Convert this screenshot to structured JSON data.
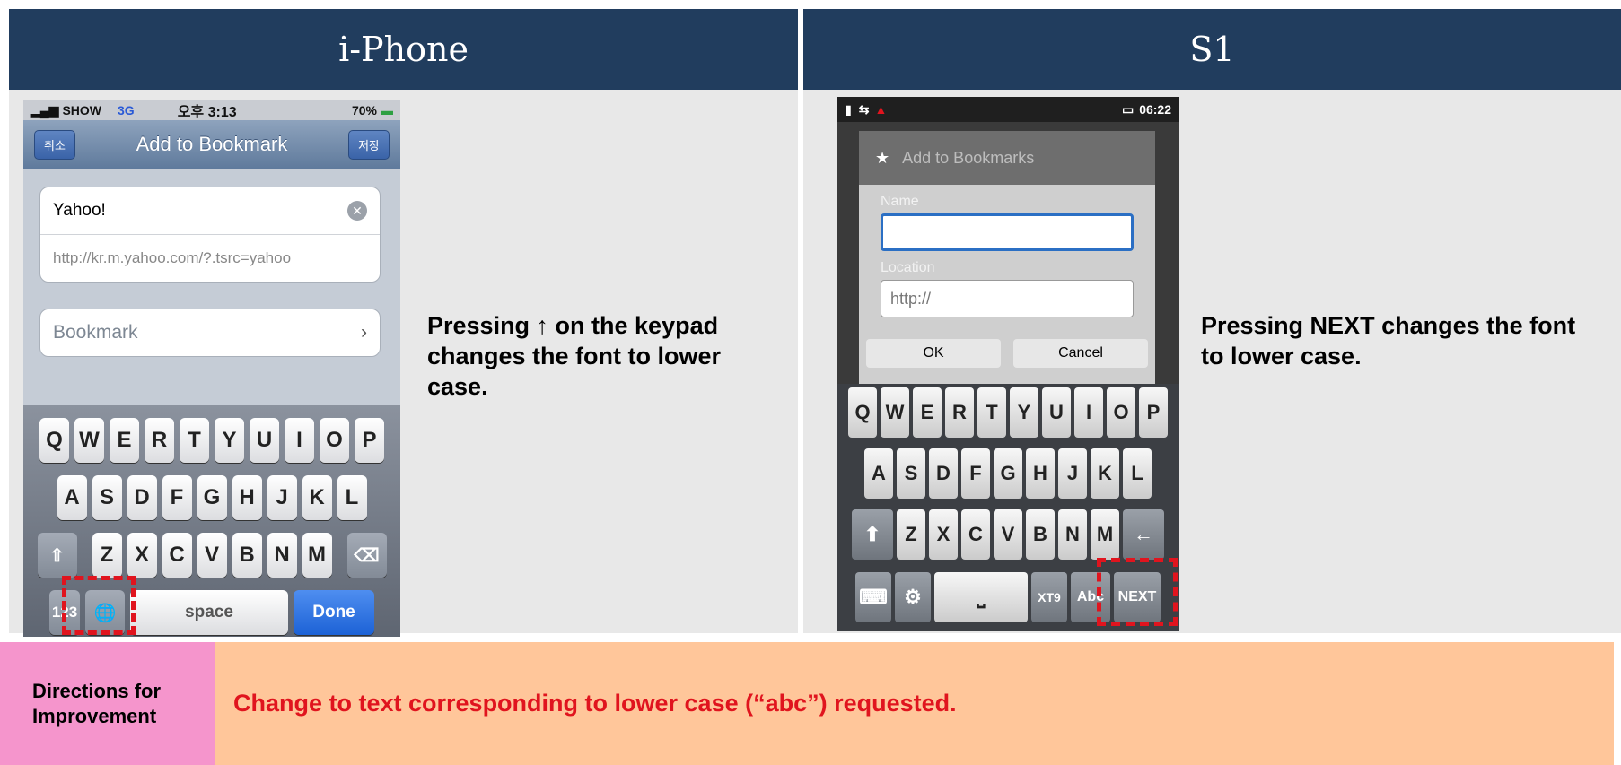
{
  "headers": {
    "left": "i-Phone",
    "right": "S1"
  },
  "iphone": {
    "status": {
      "carrier": "SHOW",
      "network": "3G",
      "time": "오후 3:13",
      "battery": "70%"
    },
    "nav": {
      "cancel": "취소",
      "title": "Add to Bookmark",
      "save": "저장"
    },
    "fields": {
      "title_value": "Yahoo!",
      "url_value": "http://kr.m.yahoo.com/?.tsrc=yahoo",
      "folder": "Bookmark"
    },
    "keyboard": {
      "row1": [
        "Q",
        "W",
        "E",
        "R",
        "T",
        "Y",
        "U",
        "I",
        "O",
        "P"
      ],
      "row2": [
        "A",
        "S",
        "D",
        "F",
        "G",
        "H",
        "J",
        "K",
        "L"
      ],
      "row3": [
        "Z",
        "X",
        "C",
        "V",
        "B",
        "N",
        "M"
      ],
      "num_key": "123",
      "space": "space",
      "done": "Done"
    }
  },
  "android": {
    "status": {
      "time": "06:22"
    },
    "dialog": {
      "title": "Add to Bookmarks",
      "name_label": "Name",
      "location_label": "Location",
      "location_value": "http://",
      "ok": "OK",
      "cancel": "Cancel"
    },
    "keyboard": {
      "row1": [
        "Q",
        "W",
        "E",
        "R",
        "T",
        "Y",
        "U",
        "I",
        "O",
        "P"
      ],
      "row2": [
        "A",
        "S",
        "D",
        "F",
        "G",
        "H",
        "J",
        "K",
        "L"
      ],
      "row3": [
        "Z",
        "X",
        "C",
        "V",
        "B",
        "N",
        "M"
      ],
      "xt9": "XT9",
      "abc": "Abc",
      "next": "NEXT"
    }
  },
  "descriptions": {
    "left": "Pressing ↑ on the keypad changes the font to lower case.",
    "right": "Pressing NEXT changes the font to lower case."
  },
  "improvement": {
    "label": "Directions for Improvement",
    "text": "Change to text corresponding to lower case (“abc”) requested."
  },
  "colors": {
    "header_bg": "#213d5e",
    "highlight": "#e0141e",
    "label_bg": "#f595cc",
    "text_bg": "#ffc69a"
  }
}
